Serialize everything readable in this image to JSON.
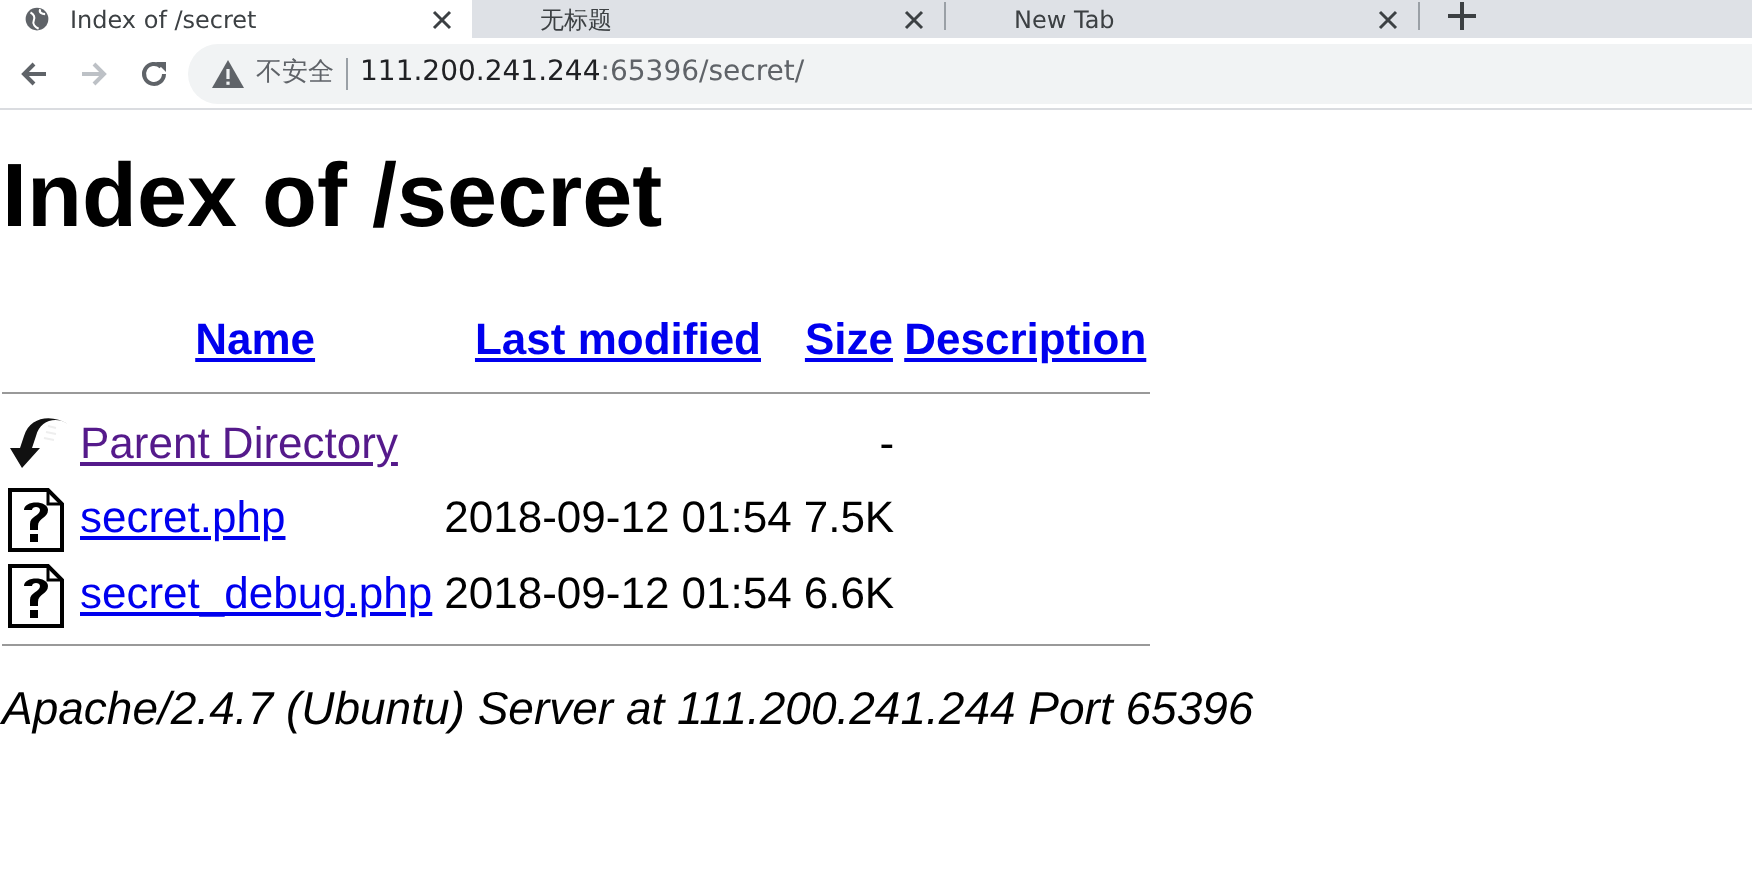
{
  "browser": {
    "tabs": [
      {
        "title": "Index of /secret",
        "selected": true
      },
      {
        "title": "无标题",
        "selected": false
      },
      {
        "title": "New Tab",
        "selected": false
      }
    ],
    "security_label": "不安全",
    "url_host": "111.200.241.244",
    "url_rest": ":65396/secret/"
  },
  "page": {
    "heading": "Index of /secret",
    "columns": [
      "Name",
      "Last modified",
      "Size",
      "Description"
    ],
    "rows": [
      {
        "kind": "parent",
        "name": "Parent Directory",
        "visited": true,
        "modified": "",
        "size": "-"
      },
      {
        "kind": "file",
        "name": "secret.php",
        "visited": false,
        "modified": "2018-09-12 01:54",
        "size": "7.5K"
      },
      {
        "kind": "file",
        "name": "secret_debug.php",
        "visited": false,
        "modified": "2018-09-12 01:54",
        "size": "6.6K"
      }
    ],
    "footer": "Apache/2.4.7 (Ubuntu) Server at 111.200.241.244 Port 65396"
  }
}
